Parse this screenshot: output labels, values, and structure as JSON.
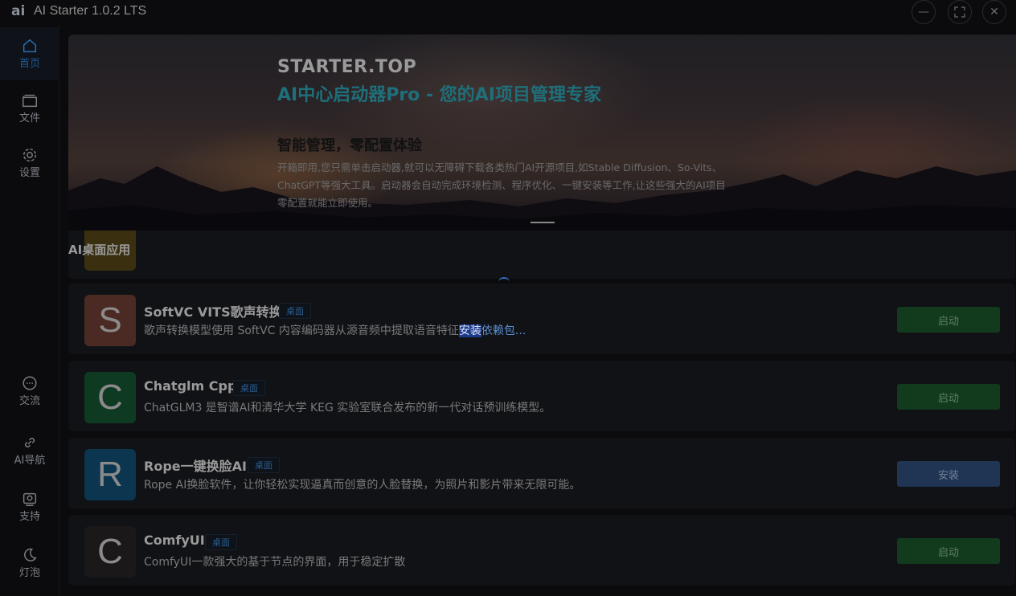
{
  "window": {
    "logo": "ai",
    "title": "AI Starter 1.0.2 LTS",
    "controls": [
      "minimize",
      "maximize",
      "close"
    ]
  },
  "sidebar": {
    "items": [
      {
        "label": "首页",
        "icon": "home-icon",
        "active": true
      },
      {
        "label": "文件",
        "icon": "folder-icon",
        "active": false
      },
      {
        "label": "设置",
        "icon": "gear-icon",
        "active": false
      },
      {
        "label": "交流",
        "icon": "chat-icon",
        "active": false
      },
      {
        "label": "AI导航",
        "icon": "link-icon",
        "active": false
      },
      {
        "label": "支持",
        "icon": "support-icon",
        "active": false
      },
      {
        "label": "灯泡",
        "icon": "moon-icon",
        "active": false
      }
    ]
  },
  "banner": {
    "brand": "STARTER.TOP",
    "headline": "AI中心启动器Pro - 您的AI项目管理专家",
    "subtitle": "智能管理，零配置体验",
    "description_line1": "开箱即用,您只需单击启动器,就可以无障碍下载各类热门AI开源项目,如Stable Diffusion、So-Vits、",
    "description_line2": "ChatGPT等强大工具。启动器会自动完成环境检测、程序优化、一键安装等工作,让这些强大的AI项目",
    "description_line3": "零配置就能立即使用。"
  },
  "section": {
    "title": "AI桌面应用"
  },
  "apps": [
    {
      "letter": "S",
      "name": "SoftVC VITS歌声转换",
      "tag": "桌面",
      "desc_before": "歌声转换模型使用 SoftVC 内容编码器从源音频中提取语音特征",
      "desc_selected": "安装",
      "desc_after": "依赖包...",
      "button": "启动",
      "icon_color": "#4a2a22"
    },
    {
      "letter": "C",
      "name": "Chatglm Cpp",
      "tag": "桌面",
      "desc": "ChatGLM3 是智谱AI和清华大学 KEG 实验室联合发布的新一代对话预训练模型。",
      "button": "启动",
      "icon_color": "#0f3a22"
    },
    {
      "letter": "R",
      "name": "Rope一键换脸AI",
      "tag": "桌面",
      "desc": "Rope AI换脸软件，让你轻松实现逼真而创意的人脸替换，为照片和影片带来无限可能。",
      "button": "安装",
      "icon_color": "#0c3550"
    },
    {
      "letter": "C",
      "name": "ComfyUI",
      "tag": "桌面",
      "desc": "ComfyUI一款强大的基于节点的界面，用于稳定扩散",
      "button": "启动",
      "icon_color": "#1a1818"
    }
  ]
}
